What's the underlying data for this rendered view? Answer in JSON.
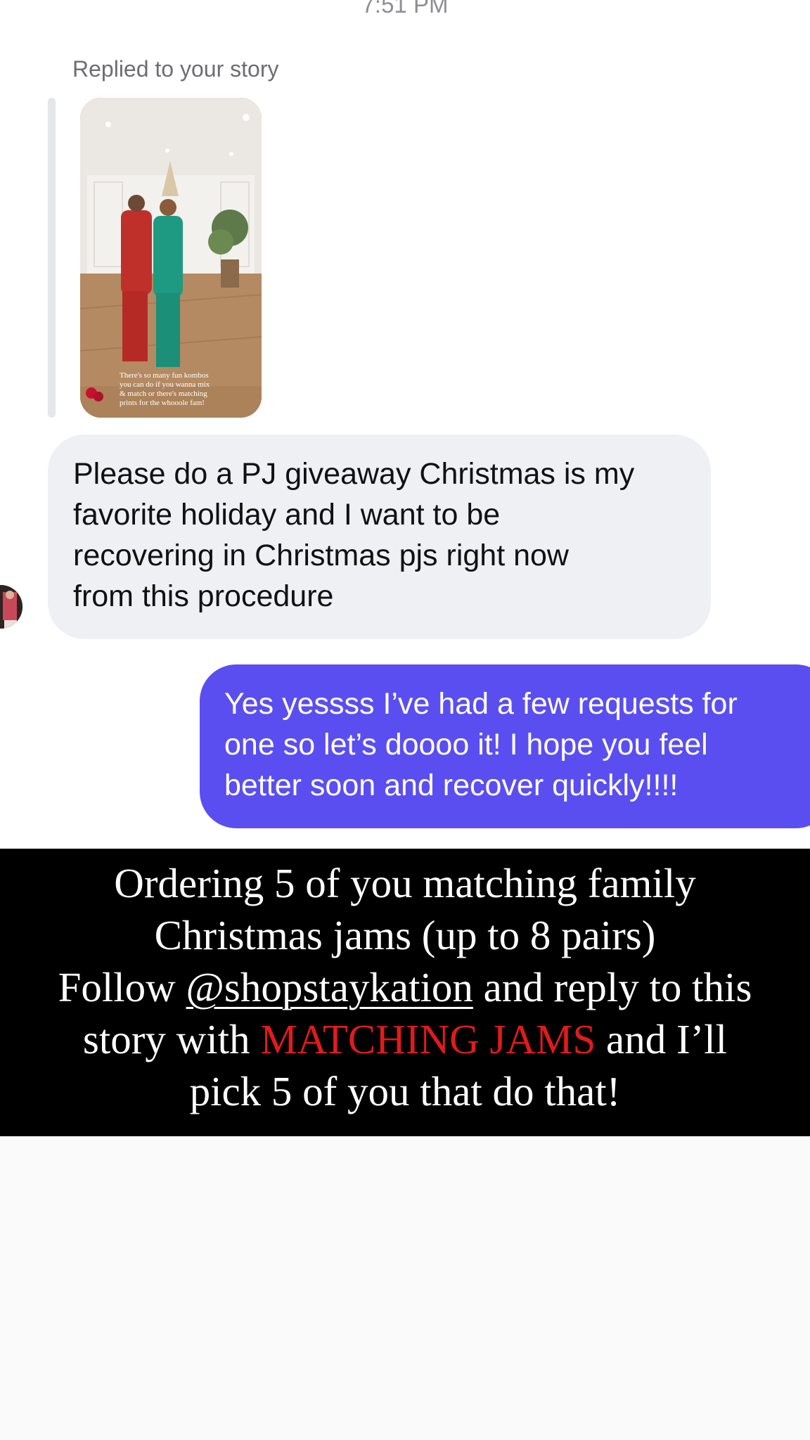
{
  "conversation": {
    "timestamp": "7:51 PM",
    "story_reply": {
      "label": "Replied to your story",
      "story_caption_lines": [
        "There's so many fun kombos",
        "you can do if you wanna mix",
        "& match or there's matching",
        "prints for the whooole fam!"
      ]
    },
    "incoming_message": {
      "lines": [
        "Please do a PJ giveaway Christmas is my",
        "favorite holiday and I want to be",
        "recovering in Christmas pjs right now",
        "from this procedure"
      ]
    },
    "outgoing_message": {
      "lines": [
        "Yes yessss I’ve had a few requests for",
        "one so let’s doooo it! I hope you feel",
        "better soon and recover quickly!!!!"
      ],
      "bubble_color": "#5b4ef0"
    }
  },
  "story_overlay": {
    "line1": "Ordering 5 of you matching family",
    "line2": "Christmas jams (up to 8 pairs)",
    "line3_prefix": "Follow",
    "handle": "@shopstaykation",
    "line3_suffix": "and reply to this",
    "line4_prefix": "story with",
    "keyword": "MATCHING JAMS",
    "line4_suffix": "and I’ll",
    "line5": "pick 5 of you that do that!",
    "keyword_color": "#e11b1b"
  }
}
